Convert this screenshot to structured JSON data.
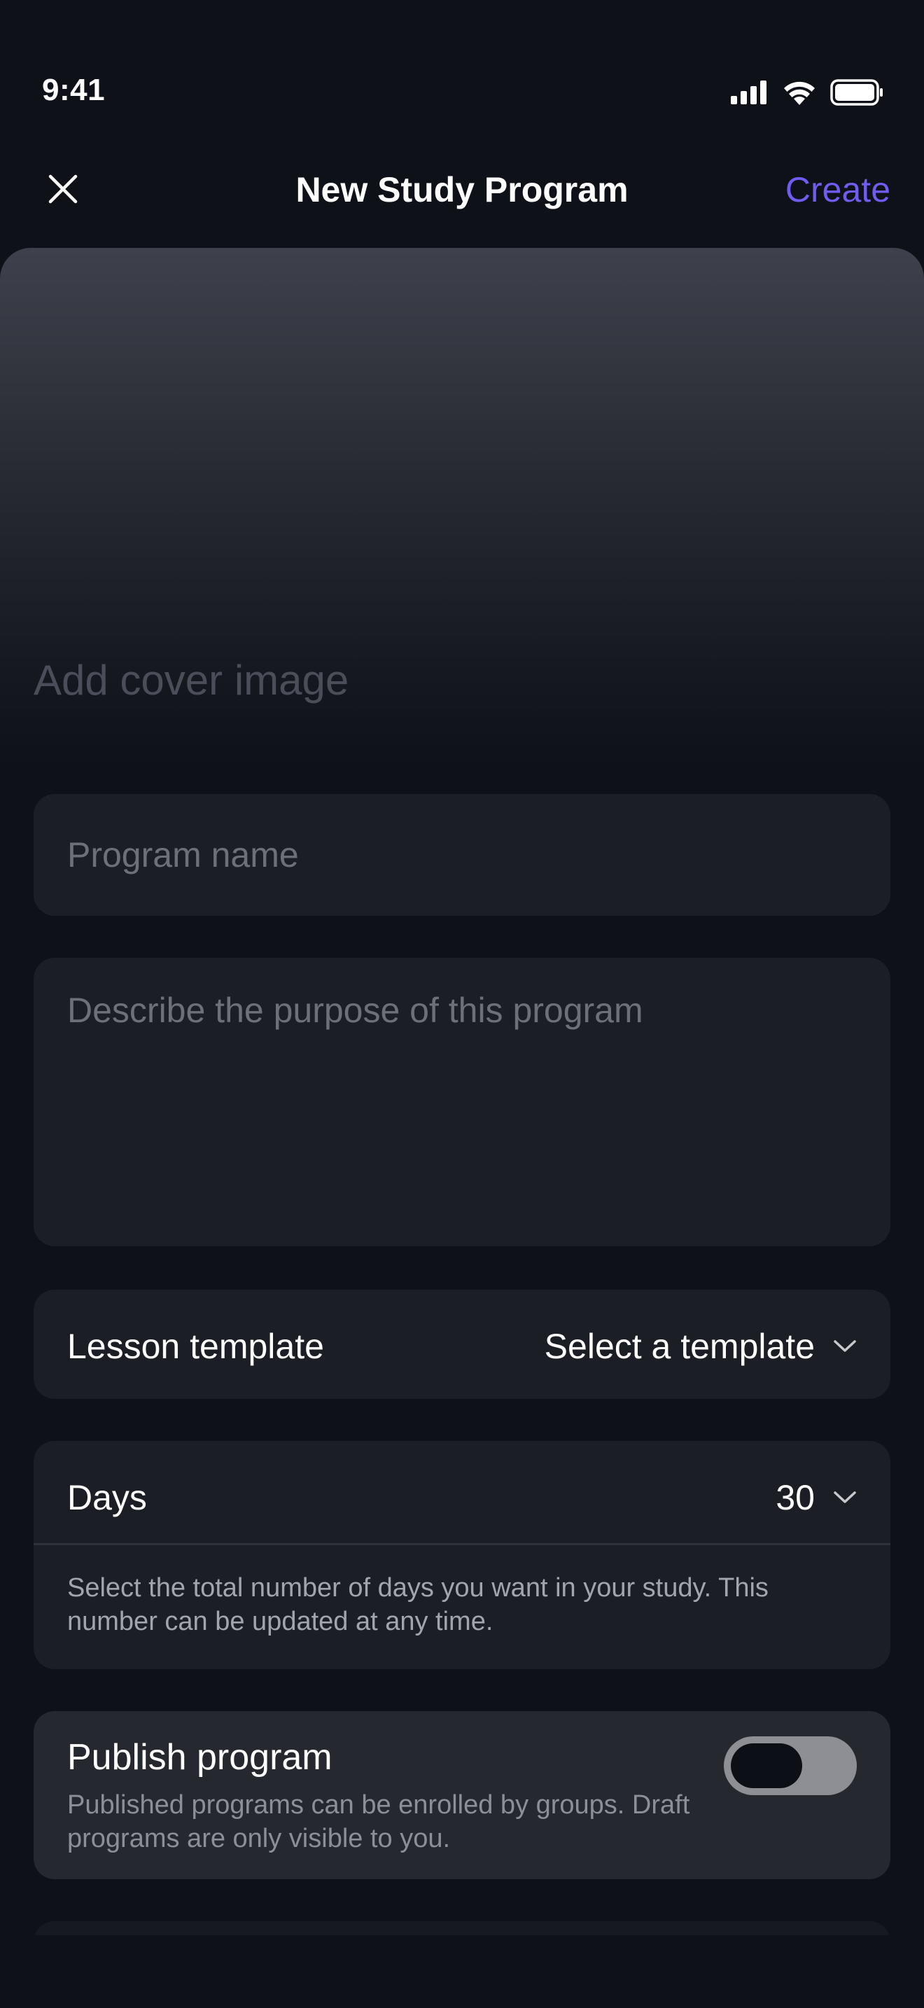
{
  "status_bar": {
    "time": "9:41",
    "icons": [
      "cellular-signal-icon",
      "wifi-icon",
      "battery-icon"
    ]
  },
  "nav": {
    "close_icon": "close-icon",
    "title": "New Study Program",
    "create_label": "Create"
  },
  "cover": {
    "label": "Add cover image"
  },
  "form": {
    "name_placeholder": "Program name",
    "description_placeholder": "Describe the purpose of this program",
    "lesson_template": {
      "label": "Lesson template",
      "value": "Select a template"
    },
    "days": {
      "label": "Days",
      "value": "30",
      "help": "Select the total number of days you want in your study. This number can be updated at any time."
    },
    "publish": {
      "title": "Publish program",
      "help": "Published programs can be enrolled by groups. Draft programs are only visible to you.",
      "enabled": false
    }
  },
  "colors": {
    "background": "#0f1119",
    "card": "#1c1e26",
    "accent": "#6f5cf0",
    "placeholder": "#6e7079",
    "secondary_text": "#a3a5ad"
  }
}
